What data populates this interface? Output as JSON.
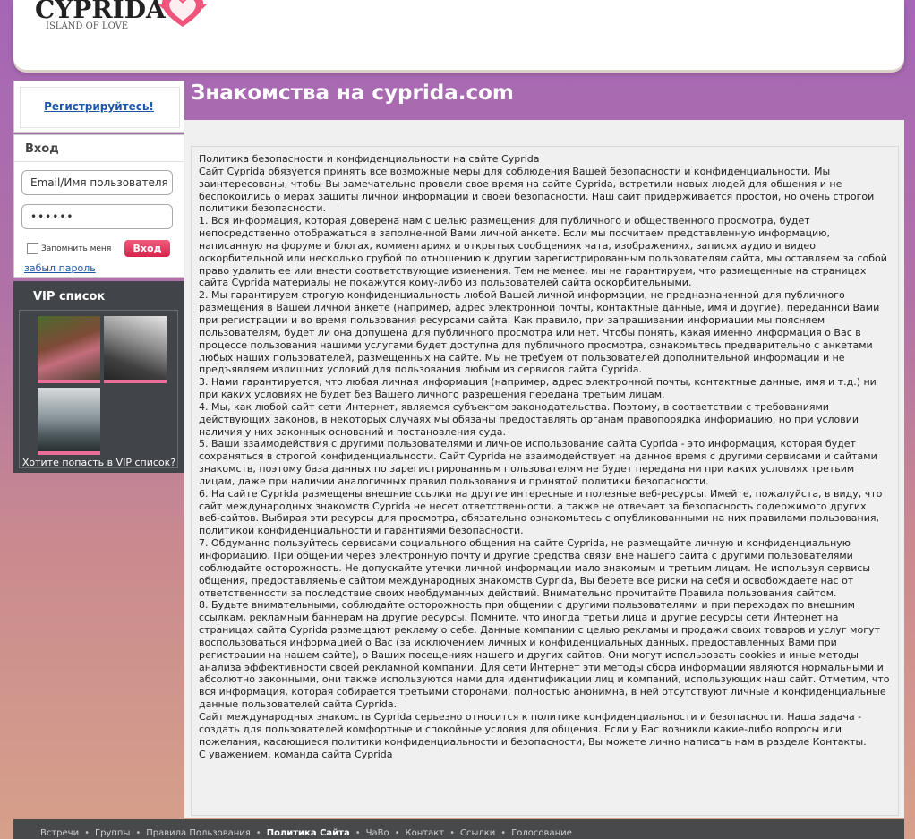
{
  "header": {
    "logo_title": "CYPRIDA",
    "logo_subtitle": "ISLAND OF LOVE"
  },
  "sidebar": {
    "register_link": "Регистрируйтесь!",
    "login": {
      "title": "Вход",
      "email_placeholder": "Email/Имя пользователя",
      "password_value": "••••••",
      "remember_label": "Запомнить меня",
      "submit_label": "Вход",
      "forgot_link": "забыл пароль"
    },
    "vip": {
      "title": "VIP список",
      "join_link": "Хотите попасть в VIP список?"
    }
  },
  "main": {
    "title": "Знакомства на cyprida.com",
    "policy_paragraphs": [
      "Политика безопасности и конфиденциальности на сайте Cyprida",
      "Сайт Cyprida обязуется принять все возможные меры для соблюдения Вашей безопасности и конфиденциальности. Мы заинтересованы, чтобы Вы замечательно провели свое время на сайте Cyprida, встретили новых людей для общения и не беспокоились о мерах защиты личной информации и своей безопасности. Наш сайт придерживается простой, но очень строгой политики безопасности.",
      "1. Вся информация, которая доверена нам с целью размещения для публичного и общественного просмотра, будет непосредственно отображаться в заполненной Вами личной анкете. Если мы посчитаем представленную информацию, написанную на форуме и блогах, комментариях и открытых сообщениях чата, изображениях, записях аудио и видео оскорбительной или несколько грубой по отношению к другим зарегистрированным пользователям сайта, мы оставляем за собой право удалить ее или внести соответствующие изменения. Тем не менее, мы не гарантируем, что размещенные на страницах сайта Cyprida материалы не покажутся кому-либо из пользователей сайта оскорбительными.",
      "2. Мы гарантируем строгую конфиденциальность любой Вашей личной информации, не предназначенной для публичного размещения в Вашей личной анкете (например, адрес электронной почты, контактные данные, имя и другие), переданной Вами при регистрации и во время пользования ресурсами сайта. Как правило, при запрашивании информации мы поясняем пользователям, будет ли она допущена для публичного просмотра или нет. Чтобы понять, какая именно информация о Вас в процессе пользования нашими услугами будет доступна для публичного просмотра, ознакомьтесь предварительно с анкетами любых наших пользователей, размещенных на сайте. Мы не требуем от пользователей дополнительной информации и не предъявляем излишних условий для пользования любым из сервисов сайта Cyprida.",
      "3. Нами гарантируется, что любая личная информация (например, адрес электронной почты, контактные данные, имя и т.д.) ни при каких условиях не будет без Вашего личного разрешения передана третьим лицам.",
      "4. Мы, как любой сайт сети Интернет, являемся субъектом законодательства. Поэтому, в соответствии с требованиями действующих законов, в некоторых случаях мы обязаны предоставлять органам правопорядка информацию, но при условии наличия у них законных оснований и постановления суда.",
      "5. Ваши взаимодействия с другими пользователями и личное использование сайта Cyprida - это информация, которая будет сохраняться в строгой конфиденциальности. Сайт Cyprida не взаимодействует на данное время с другими сервисами и сайтами знакомств, поэтому база данных по зарегистрированным пользователям не будет передана ни при каких условиях третьим лицам, даже при наличии аналогичных правил пользования и принятой политики безопасности.",
      "6. На сайте Cyprida размещены внешние ссылки на другие интересные и полезные веб-ресурсы. Имейте, пожалуйста, в виду, что сайт международных знакомств Cyprida не несет ответственности, а также не отвечает за безопасность содержимого других веб-сайтов. Выбирая эти ресурсы для просмотра, обязательно ознакомьтесь с опубликованными на них правилами пользования, политикой конфиденциальности и гарантиями безопасности.",
      "7. Обдуманно пользуйтесь сервисами социального общения на сайте Cyprida, не размещайте личную и конфиденциальную информацию. При общении через электронную почту и другие средства связи вне нашего сайта с другими пользователями соблюдайте осторожность. Не допускайте утечки личной информации мало знакомым и третьим лицам. Не используя сервисы общения, предоставляемые сайтом международных знакомств Cyprida, Вы берете все риски на себя и освобождаете нас от ответственности за последствие своих необдуманных действий. Внимательно прочитайте Правила пользования сайтом.",
      "8. Будьте внимательными, соблюдайте осторожность при общении с другими пользователями и при переходах по внешним ссылкам, рекламным баннерам на другие ресурсы. Помните, что иногда третьи лица и другие ресурсы сети Интернет на страницах сайта Cyprida размещают рекламу о себе. Данные компании с целью рекламы и продажи своих товаров и услуг могут воспользоваться информацией о Вас (за исключением личных и конфиденциальных данных, предоставленных Вами при регистрации на нашем сайте), о Ваших посещениях нашего и других сайтов. Они могут использовать cookies и иные методы анализа эффективности своей рекламной компании. Для сети Интернет эти методы сбора информации являются нормальными и абсолютно законными, они также используются нами для идентификации лиц и компаний, использующих наш сайт. Отметим, что вся информация, которая собирается третьими сторонами, полностью анонимна, в ней отсутствуют личные и конфиденциальные данные пользователей сайта Cyprida.",
      "Сайт международных знакомств Cyprida серьезно относится к политике конфиденциальности и безопасности. Наша задача - создать для пользователей комфортные и спокойные условия для общения. Если у Вас возникли какие-либо вопросы или пожелания, касающиеся политики конфиденциальности и безопасности, Вы можете лично написать нам в разделе Контакты.",
      "С уважением, команда сайта Cyprida"
    ]
  },
  "footer": {
    "links": [
      "Встречи",
      "Группы",
      "Правила Пользования",
      "Политика Сайта",
      "ЧаВо",
      "Контакт",
      "Ссылки",
      "Голосование"
    ],
    "active_index": 3
  },
  "colors": {
    "accent_pink": "#d8234b",
    "link_blue": "#1e55a8",
    "vip_bar": "#ec6d98"
  }
}
